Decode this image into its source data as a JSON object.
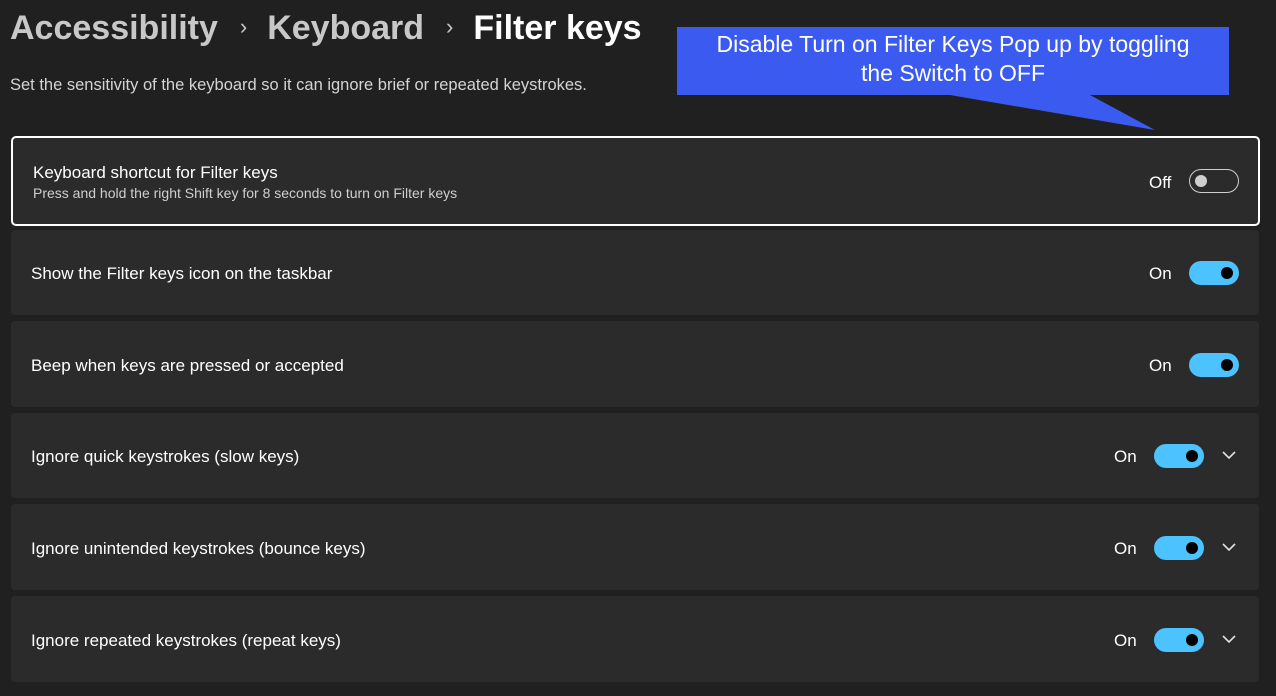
{
  "breadcrumb": {
    "items": [
      "Accessibility",
      "Keyboard",
      "Filter keys"
    ]
  },
  "subtitle": "Set the sensitivity of the keyboard so it can ignore brief or repeated keystrokes.",
  "callout": {
    "text_line1": "Disable Turn on Filter Keys Pop up by toggling",
    "text_line2": "the Switch to OFF",
    "color": "#3b5bf0"
  },
  "settings": [
    {
      "title": "Keyboard shortcut for Filter keys",
      "description": "Press and hold the right Shift key for 8 seconds to turn on Filter keys",
      "state": "Off",
      "toggle_on": false,
      "expandable": false
    },
    {
      "title": "Show the Filter keys icon on the taskbar",
      "state": "On",
      "toggle_on": true,
      "expandable": false
    },
    {
      "title": "Beep when keys are pressed or accepted",
      "state": "On",
      "toggle_on": true,
      "expandable": false
    },
    {
      "title": "Ignore quick keystrokes (slow keys)",
      "state": "On",
      "toggle_on": true,
      "expandable": true
    },
    {
      "title": "Ignore unintended keystrokes (bounce keys)",
      "state": "On",
      "toggle_on": true,
      "expandable": true
    },
    {
      "title": "Ignore repeated keystrokes (repeat keys)",
      "state": "On",
      "toggle_on": true,
      "expandable": true
    }
  ],
  "colors": {
    "accent": "#4cc2ff",
    "background": "#202020",
    "card": "#2b2b2b"
  }
}
